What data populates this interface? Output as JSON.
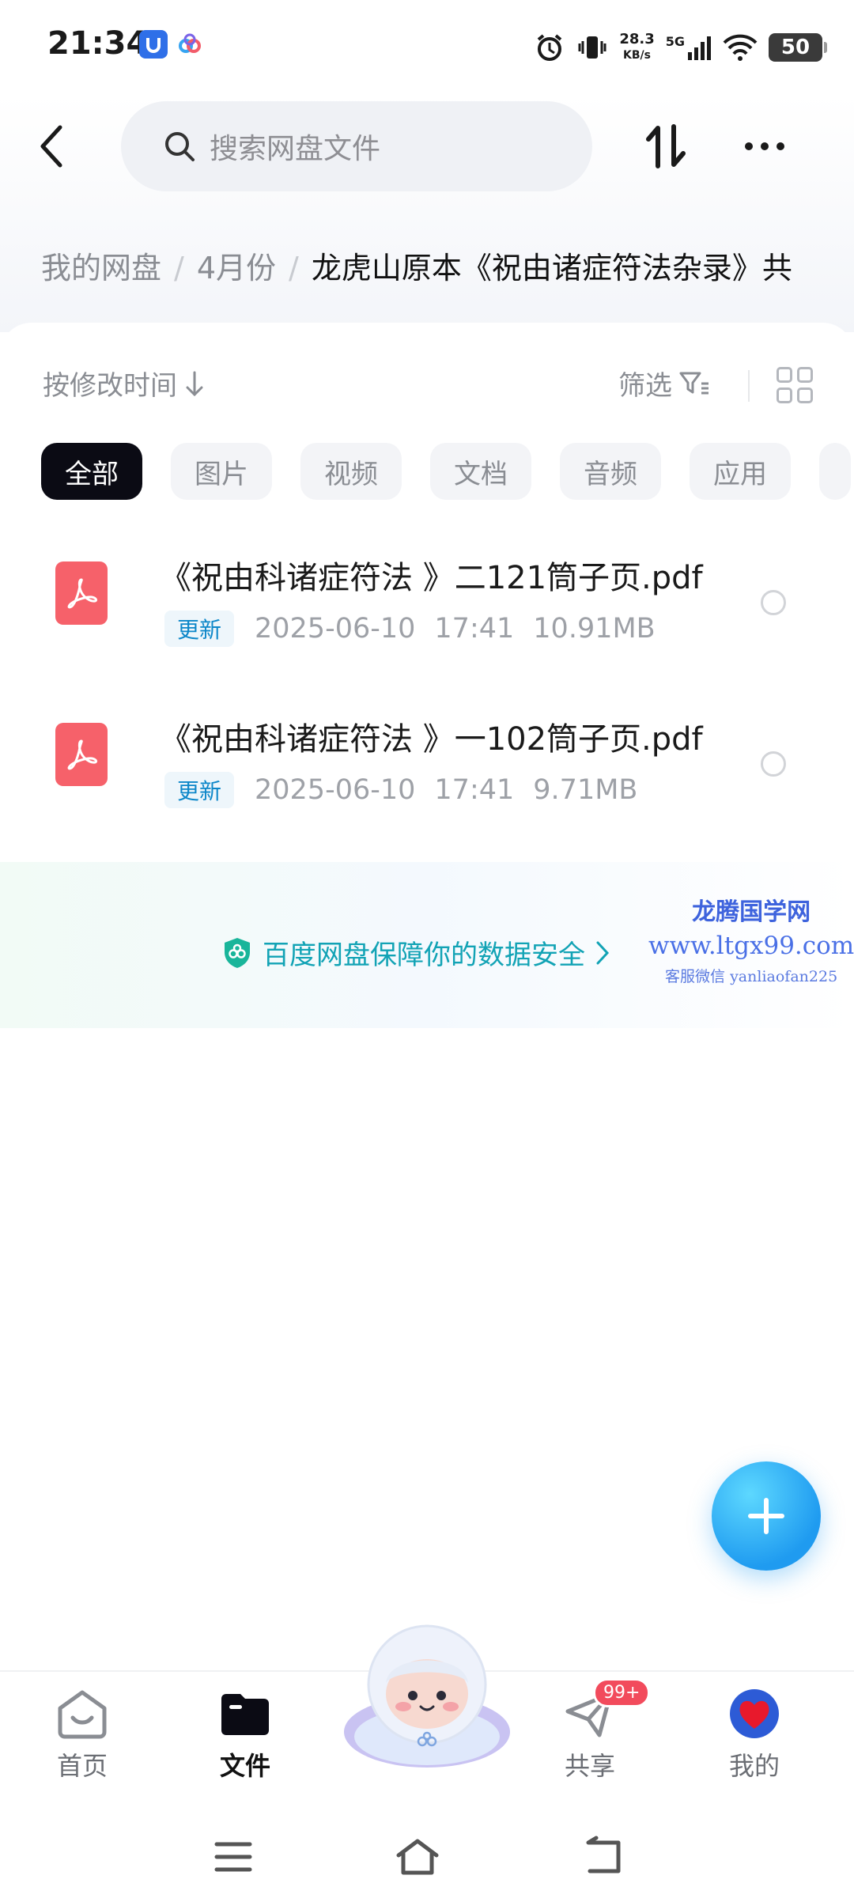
{
  "status_bar": {
    "time": "21:34",
    "net_speed_value": "28.3",
    "net_speed_unit": "KB/s",
    "network": "5G",
    "battery": "50"
  },
  "header": {
    "search_placeholder": "搜索网盘文件"
  },
  "breadcrumb": {
    "root": "我的网盘",
    "folder": "4月份",
    "current": "龙虎山原本《祝由诸症符法杂录》共"
  },
  "toolbar": {
    "sort_label": "按修改时间",
    "filter_label": "筛选"
  },
  "chips": [
    "全部",
    "图片",
    "视频",
    "文档",
    "音频",
    "应用"
  ],
  "files": [
    {
      "name": "《祝由科诸症符法 》二121筒子页.pdf",
      "tag": "更新",
      "date": "2025-06-10",
      "time": "17:41",
      "size": "10.91MB"
    },
    {
      "name": "《祝由科诸症符法 》一102筒子页.pdf",
      "tag": "更新",
      "date": "2025-06-10",
      "time": "17:41",
      "size": "9.71MB"
    }
  ],
  "safety_notice": "百度网盘保障你的数据安全",
  "watermark": {
    "title": "龙腾国学网",
    "url": "www.ltgx99.com",
    "contact": "客服微信 yanliaofan225"
  },
  "bottom_nav": {
    "home": "首页",
    "files": "文件",
    "share": "共享",
    "share_badge": "99+",
    "me": "我的"
  },
  "colors": {
    "accent": "#1f9bf0",
    "pdf": "#f6616a",
    "active_chip": "#0b0b14",
    "safety_text": "#12a3b5"
  }
}
